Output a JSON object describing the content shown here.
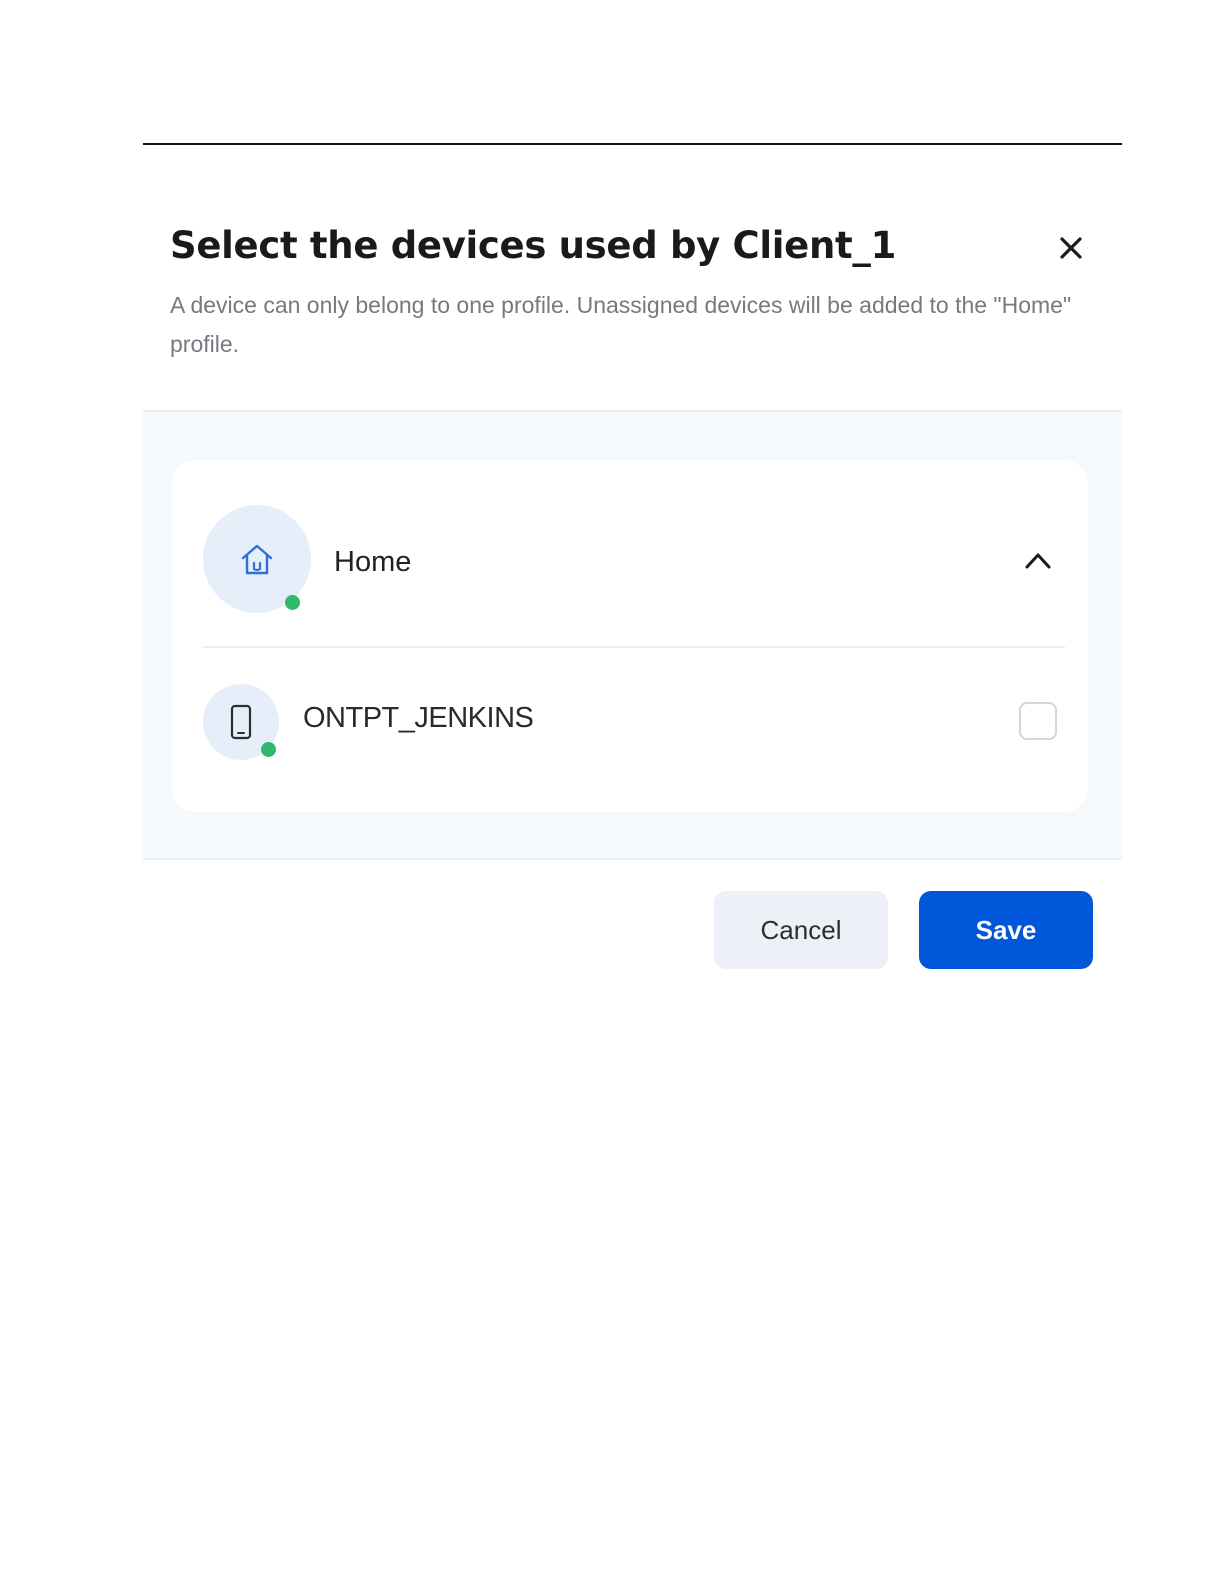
{
  "dialog": {
    "title": "Select the devices used by Client_1",
    "subtitle": "A device can only belong to one profile. Unassigned devices will be added to the \"Home\" profile.",
    "close_icon": "close-icon"
  },
  "profile": {
    "name": "Home",
    "icon": "home-icon",
    "status": "online",
    "expanded": true,
    "toggle_icon": "chevron-up-icon"
  },
  "devices": [
    {
      "name": "ONTPT_JENKINS",
      "icon": "smartphone-icon",
      "status": "online",
      "checked": false
    }
  ],
  "actions": {
    "cancel_label": "Cancel",
    "save_label": "Save"
  },
  "colors": {
    "primary": "#0057d9",
    "status_online": "#2fb96a",
    "avatar_bg": "#e6eef9",
    "list_bg": "#f6f9fb",
    "icon_blue": "#2f6fd6"
  }
}
